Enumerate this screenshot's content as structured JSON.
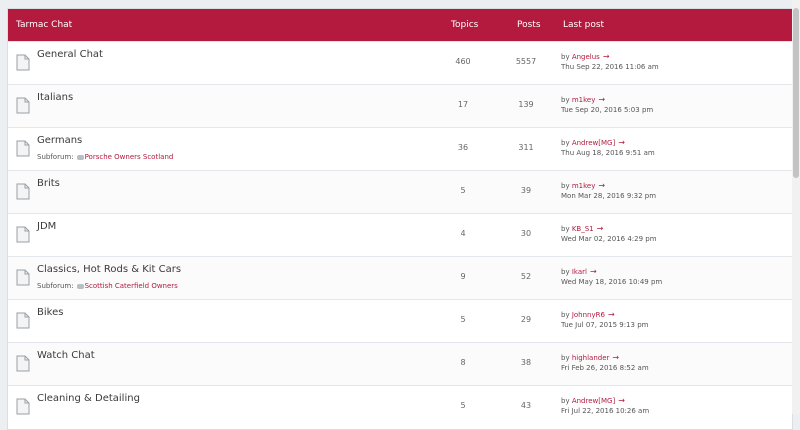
{
  "header": {
    "title": "Tarmac Chat",
    "col_topics": "Topics",
    "col_posts": "Posts",
    "col_last": "Last post"
  },
  "colors": {
    "accent": "#b41a3e",
    "link": "#b41a3e"
  },
  "by_label": "by",
  "subforum_label": "Subforum:",
  "forums": [
    {
      "title": "General Chat",
      "topics": "460",
      "posts": "5557",
      "author": "Angelus",
      "date": "Thu Sep 22, 2016 11:06 am"
    },
    {
      "title": "Italians",
      "topics": "17",
      "posts": "139",
      "author": "m1key",
      "date": "Tue Sep 20, 2016 5:03 pm"
    },
    {
      "title": "Germans",
      "subforum": "Porsche Owners Scotland",
      "topics": "36",
      "posts": "311",
      "author": "Andrew[MG]",
      "date": "Thu Aug 18, 2016 9:51 am"
    },
    {
      "title": "Brits",
      "topics": "5",
      "posts": "39",
      "author": "m1key",
      "date": "Mon Mar 28, 2016 9:32 pm"
    },
    {
      "title": "JDM",
      "topics": "4",
      "posts": "30",
      "author": "KB_S1",
      "date": "Wed Mar 02, 2016 4:29 pm"
    },
    {
      "title": "Classics, Hot Rods & Kit Cars",
      "subforum": "Scottish Caterfield Owners",
      "topics": "9",
      "posts": "52",
      "author": "Ikarl",
      "date": "Wed May 18, 2016 10:49 pm"
    },
    {
      "title": "Bikes",
      "topics": "5",
      "posts": "29",
      "author": "JohnnyR6",
      "date": "Tue Jul 07, 2015 9:13 pm"
    },
    {
      "title": "Watch Chat",
      "topics": "8",
      "posts": "38",
      "author": "highlander",
      "date": "Fri Feb 26, 2016 8:52 am"
    },
    {
      "title": "Cleaning & Detailing",
      "topics": "5",
      "posts": "43",
      "author": "Andrew[MG]",
      "date": "Fri Jul 22, 2016 10:26 am"
    }
  ]
}
